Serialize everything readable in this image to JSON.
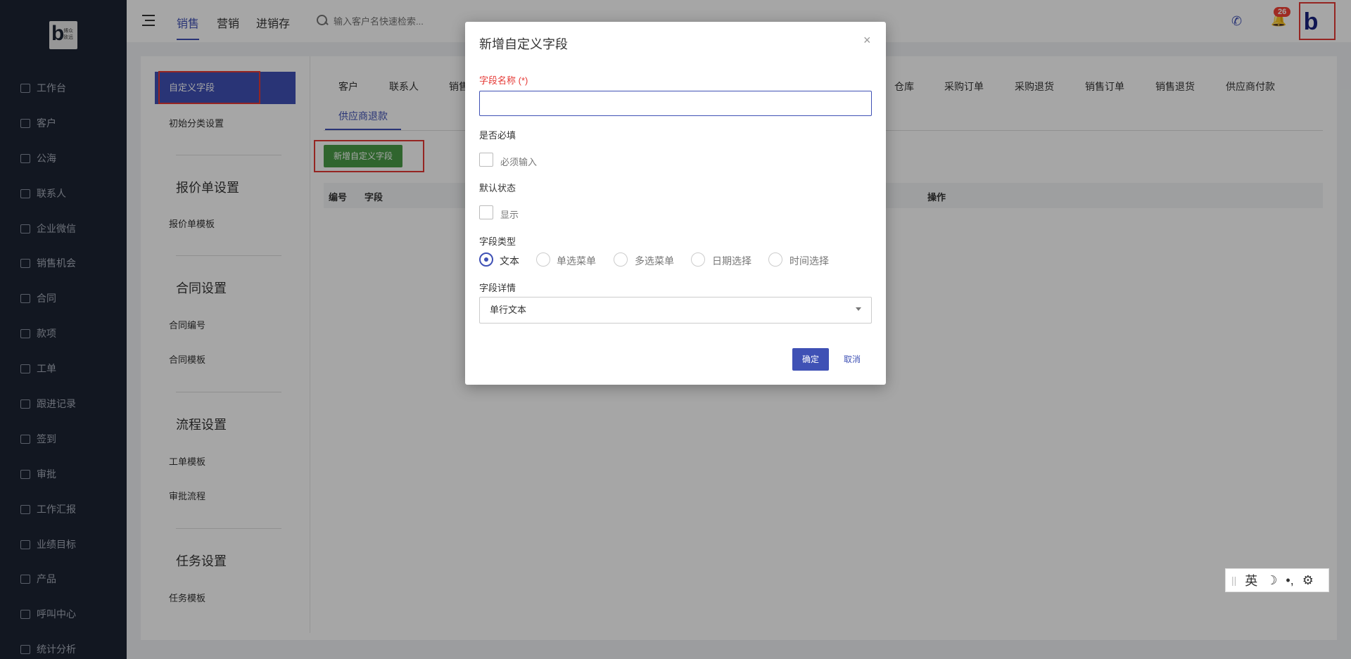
{
  "sidebar": {
    "logo_text": "博众 致远",
    "logo_letter": "b",
    "items": [
      {
        "label": "工作台"
      },
      {
        "label": "客户"
      },
      {
        "label": "公海"
      },
      {
        "label": "联系人"
      },
      {
        "label": "企业微信"
      },
      {
        "label": "销售机会"
      },
      {
        "label": "合同"
      },
      {
        "label": "款项"
      },
      {
        "label": "工单"
      },
      {
        "label": "跟进记录"
      },
      {
        "label": "签到"
      },
      {
        "label": "审批"
      },
      {
        "label": "工作汇报"
      },
      {
        "label": "业绩目标"
      },
      {
        "label": "产品"
      },
      {
        "label": "呼叫中心"
      },
      {
        "label": "统计分析"
      }
    ]
  },
  "topbar": {
    "tabs": [
      "销售",
      "营销",
      "进销存"
    ],
    "active_tab": "销售",
    "search_placeholder": "输入客户名快速检索...",
    "notification_count": "26",
    "avatar_letter": "b"
  },
  "settings_nav": {
    "active_item": "自定义字段",
    "item_initial_category": "初始分类设置",
    "sections": [
      {
        "title": "报价单设置",
        "items": [
          "报价单模板"
        ]
      },
      {
        "title": "合同设置",
        "items": [
          "合同编号",
          "合同模板"
        ]
      },
      {
        "title": "流程设置",
        "items": [
          "工单模板",
          "审批流程"
        ]
      },
      {
        "title": "任务设置",
        "items": [
          "任务模板"
        ]
      }
    ]
  },
  "type_tabs": {
    "row1": [
      "客户",
      "联系人",
      "销售",
      "仓库",
      "采购订单",
      "采购退货",
      "销售订单",
      "销售退货",
      "供应商付款"
    ],
    "row2_active": "供应商退款"
  },
  "main": {
    "add_button": "新增自定义字段",
    "table_headers": [
      "编号",
      "字段",
      "操作"
    ]
  },
  "dialog": {
    "title": "新增自定义字段",
    "close_symbol": "×",
    "name_label": "字段名称 (*)",
    "name_value": "",
    "required_label": "是否必填",
    "required_option": "必须输入",
    "default_state_label": "默认状态",
    "default_state_option": "显示",
    "type_label": "字段类型",
    "type_options": [
      "文本",
      "单选菜单",
      "多选菜单",
      "日期选择",
      "时间选择"
    ],
    "type_selected": "文本",
    "detail_label": "字段详情",
    "detail_value": "单行文本",
    "ok_button": "确定",
    "cancel_button": "取消"
  },
  "ime": {
    "lang": "英",
    "moon": "☽",
    "punct": "•,",
    "gear": "⚙"
  },
  "colors": {
    "sidebar_bg": "#1d2433",
    "primary": "#3f51b5",
    "add_button": "#4a9b47",
    "highlight_box": "#e53935"
  }
}
